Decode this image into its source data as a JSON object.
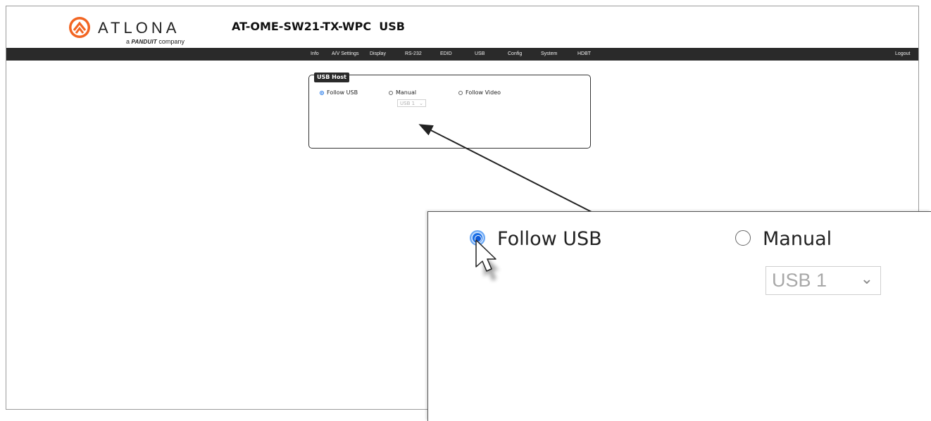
{
  "brand": {
    "name": "ATLONA",
    "tagline_prefix": "a",
    "tagline_brand": "PANDUIT",
    "tagline_suffix": "company",
    "accent_color": "#f26522"
  },
  "device_title": "AT-OME-SW21-TX-WPC  USB",
  "nav": {
    "items": [
      "Info",
      "A/V Settings",
      "Display",
      "RS-232",
      "EDID",
      "USB",
      "Config",
      "System",
      "HDBT"
    ],
    "logout": "Logout"
  },
  "usb_host": {
    "title": "USB Host",
    "options": [
      "Follow USB",
      "Manual",
      "Follow Video"
    ],
    "selected": "Follow USB",
    "manual_select_value": "USB 1",
    "manual_select_disabled": true
  },
  "zoom": {
    "options": [
      "Follow USB",
      "Manual"
    ],
    "select_value": "USB 1"
  },
  "icons": {
    "logo": "atlona-logo-icon",
    "radio": "radio-icon",
    "chevron": "chevron-down-icon",
    "cursor": "mouse-pointer-icon"
  }
}
